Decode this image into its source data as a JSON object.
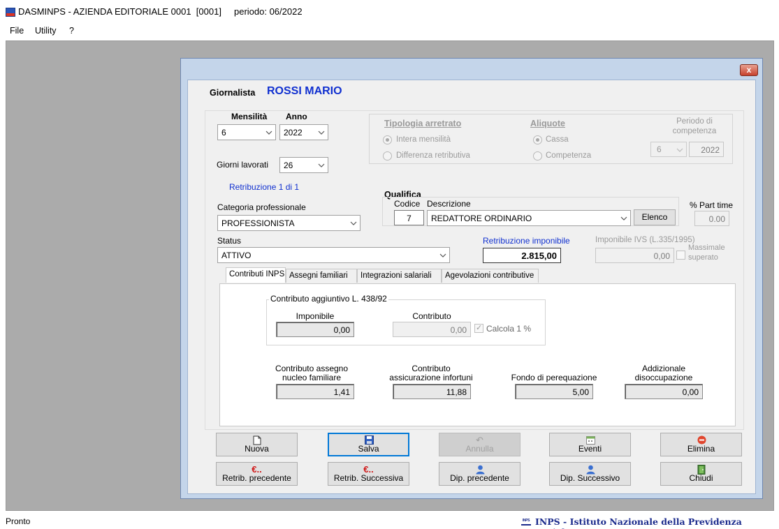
{
  "window": {
    "title": "DASMINPS - AZIENDA EDITORIALE 0001  [0001]     periodo: 06/2022"
  },
  "menu": [
    "File",
    "Utility",
    "?"
  ],
  "status": {
    "text": "Pronto",
    "logo_text": "INPS",
    "org": "INPS - Istituto Nazionale della Previdenza Sociale"
  },
  "dialog": {
    "close": "x",
    "giornalista_label": "Giornalista",
    "giornalista_name": "ROSSI MARIO",
    "mensilita_label": "Mensilità",
    "anno_label": "Anno",
    "mensilita_value": "6",
    "anno_value": "2022",
    "giorni_label": "Giorni lavorati",
    "giorni_value": "26",
    "tipologia_label": "Tipologia arretrato",
    "tipologia_options": [
      "Intera mensilità",
      "Differenza retributiva"
    ],
    "aliquote_label": "Aliquote",
    "aliquote_options": [
      "Cassa",
      "Competenza"
    ],
    "periodo_label_1": "Periodo di",
    "periodo_label_2": "competenza",
    "periodo_mese": "6",
    "periodo_anno": "2022",
    "retribuzione_n": "Retribuzione 1 di 1",
    "categoria_label": "Categoria professionale",
    "categoria_value": "PROFESSIONISTA",
    "qualifica_label": "Qualifica",
    "codice_label": "Codice",
    "codice_value": "7",
    "descrizione_label": "Descrizione",
    "descrizione_value": "REDATTORE ORDINARIO",
    "elenco_label": "Elenco",
    "part_time_label": "% Part time",
    "part_time_value": "0.00",
    "status_label": "Status",
    "status_value": "ATTIVO",
    "retr_imponibile_label": "Retribuzione imponibile",
    "retr_imponibile_value": "2.815,00",
    "imponibile_ivs_label": "Imponibile IVS (L.335/1995)",
    "imponibile_ivs_value": "0,00",
    "massimale_label_1": "Massimale",
    "massimale_label_2": "superato"
  },
  "tabs": [
    "Contributi INPS",
    "Assegni familiari",
    "Integrazioni salariali",
    "Agevolazioni contributive"
  ],
  "contributi": {
    "group_title": "Contributo aggiuntivo L. 438/92",
    "imponibile_label": "Imponibile",
    "imponibile_value": "0,00",
    "contributo_label": "Contributo",
    "contributo_value": "0,00",
    "calcola_label": "Calcola 1 %",
    "anf_label_1": "Contributo assegno",
    "anf_label_2": "nucleo familiare",
    "anf_value": "1,41",
    "inf_label_1": "Contributo",
    "inf_label_2": "assicurazione infortuni",
    "inf_value": "11,88",
    "fondo_label": "Fondo di perequazione",
    "fondo_value": "5,00",
    "add_label_1": "Addizionale",
    "add_label_2": "disoccupazione",
    "add_value": "0,00"
  },
  "buttons": {
    "nuova": "Nuova",
    "salva": "Salva",
    "annulla": "Annulla",
    "eventi": "Eventi",
    "elimina": "Elimina",
    "retrib_prec": "Retrib. precedente",
    "retrib_succ": "Retrib. Successiva",
    "dip_prec": "Dip. precedente",
    "dip_succ": "Dip. Successivo",
    "chiudi": "Chiudi",
    "euro_symbol": "€.."
  }
}
